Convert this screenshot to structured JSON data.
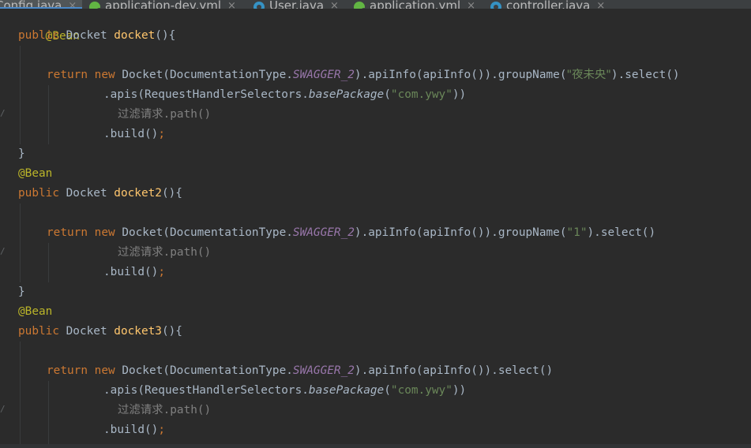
{
  "tabs": [
    {
      "label": "Config.java",
      "icon": "java-class-icon",
      "active": true
    },
    {
      "label": "application-dev.yml",
      "icon": "yml-config-icon",
      "active": false
    },
    {
      "label": "User.java",
      "icon": "java-class-icon",
      "active": false
    },
    {
      "label": "application.yml",
      "icon": "yml-config-icon",
      "active": false
    },
    {
      "label": "controller.java",
      "icon": "java-class-icon",
      "active": false
    }
  ],
  "tab_close_glyph": "×",
  "colors": {
    "background": "#2b2b2b",
    "keyword": "#cc7832",
    "annotation": "#bbb529",
    "method_declaration": "#ffc66d",
    "constant": "#9876aa",
    "string": "#6a8759",
    "default_text": "#a9b7c6",
    "comment_like": "#808080"
  },
  "code": {
    "bean1_annotation": "@Bean",
    "docket1": {
      "kw_public": "public",
      "type": " Docket ",
      "name": "docket",
      "parens": "(){",
      "kw_return": "return",
      "kw_new": "new",
      "call_start": " Docket(DocumentationType.",
      "constant": "SWAGGER_2",
      "call_mid": ").apiInfo(apiInfo()).groupName(",
      "group_name": "\"夜未央\"",
      "call_end": ").select()",
      "apis_start": ".apis(RequestHandlerSelectors.",
      "apis_method": "basePackage",
      "apis_open": "(",
      "package": "\"com.ywy\"",
      "apis_close": "))",
      "filter_cjk": "过滤请求",
      "filter_path": ".path()",
      "build": ".build()",
      "semicolon": ";",
      "close_brace": "}"
    },
    "bean2_annotation": "@Bean",
    "docket2": {
      "kw_public": "public",
      "type": " Docket ",
      "name": "docket2",
      "parens": "(){",
      "kw_return": "return",
      "kw_new": "new",
      "call_start": " Docket(DocumentationType.",
      "constant": "SWAGGER_2",
      "call_mid": ").apiInfo(apiInfo()).groupName(",
      "group_name": "\"1\"",
      "call_end": ").select()",
      "filter_cjk": "过滤请求",
      "filter_path": ".path()",
      "build": ".build()",
      "semicolon": ";",
      "close_brace": "}"
    },
    "bean3_annotation": "@Bean",
    "docket3": {
      "kw_public": "public",
      "type": " Docket ",
      "name": "docket3",
      "parens": "(){",
      "kw_return": "return",
      "kw_new": "new",
      "call_start": " Docket(DocumentationType.",
      "constant": "SWAGGER_2",
      "call_mid": ").apiInfo(apiInfo()).select()",
      "apis_start": ".apis(RequestHandlerSelectors.",
      "apis_method": "basePackage",
      "apis_open": "(",
      "package": "\"com.ywy\"",
      "apis_close": "))",
      "filter_cjk": "过滤请求",
      "filter_path": ".path()",
      "build": ".build()",
      "semicolon": ";"
    }
  },
  "gutter_glyph": "/"
}
